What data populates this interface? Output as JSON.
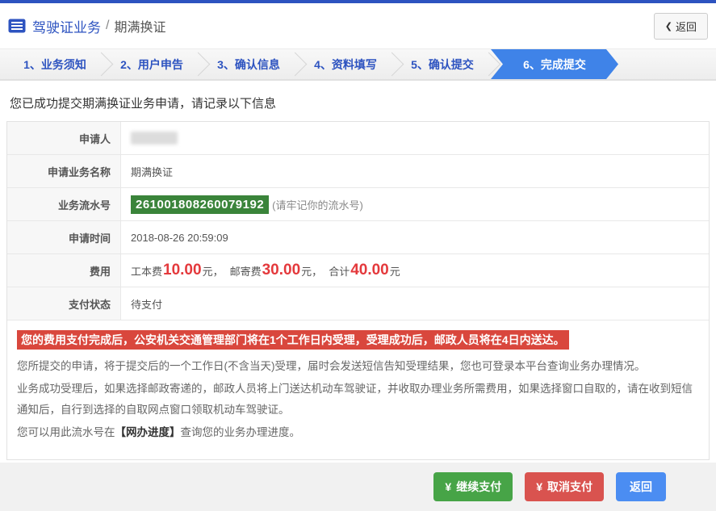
{
  "header": {
    "title": "驾驶证业务",
    "separator": "/",
    "subtitle": "期满换证",
    "back": {
      "chevron": "❮",
      "label": "返回"
    }
  },
  "steps": [
    {
      "label": "1、业务须知",
      "active": false
    },
    {
      "label": "2、用户申告",
      "active": false
    },
    {
      "label": "3、确认信息",
      "active": false
    },
    {
      "label": "4、资料填写",
      "active": false
    },
    {
      "label": "5、确认提交",
      "active": false
    },
    {
      "label": "6、完成提交",
      "active": true
    }
  ],
  "main": {
    "success_message": "您已成功提交期满换证业务申请，请记录以下信息",
    "table": {
      "applicant_label": "申请人",
      "applicant_value_redacted": true,
      "business_name_label": "申请业务名称",
      "business_name_value": "期满换证",
      "serial_label": "业务流水号",
      "serial_value": "261001808260079192",
      "serial_note": "(请牢记你的流水号)",
      "time_label": "申请时间",
      "time_value": "2018-08-26 20:59:09",
      "fee_label": "费用",
      "status_label": "支付状态",
      "status_value": "待支付"
    },
    "fee": {
      "work_label": "工本费 ",
      "work_value": "10.00",
      "unit": "元",
      "comma": "，",
      "post_label": "邮寄费 ",
      "post_value": "30.00",
      "total_label": "合计 ",
      "total_value": "40.00"
    },
    "warning": "您的费用支付完成后，公安机关交通管理部门将在1个工作日内受理，受理成功后，邮政人员将在4日内送达。",
    "paragraphs": [
      "您所提交的申请，将于提交后的一个工作日(不含当天)受理，届时会发送短信告知受理结果，您也可登录本平台查询业务办理情况。",
      "业务成功受理后，如果选择邮政寄递的，邮政人员将上门送达机动车驾驶证，并收取办理业务所需费用，如果选择窗口自取的，请在收到短信通知后，自行到选择的自取网点窗口领取机动车驾驶证。"
    ],
    "progress_note": {
      "pre": "您可以用此流水号在",
      "highlight": "【网办进度】",
      "post": "查询您的业务办理进度。"
    }
  },
  "footer": {
    "buttons": [
      {
        "icon": "¥",
        "label": "继续支付"
      },
      {
        "icon": "¥",
        "label": "取消支付"
      },
      {
        "icon": "",
        "label": "返回"
      }
    ]
  },
  "colors": {
    "accent_blue": "#2d53c0",
    "step_active_blue": "#3f83e8",
    "serial_green": "#3a843a",
    "warning_red": "#d9473d",
    "price_red": "#e4393c",
    "button_green": "#47a447",
    "button_red": "#d9534f",
    "button_blue": "#4b8df2"
  }
}
